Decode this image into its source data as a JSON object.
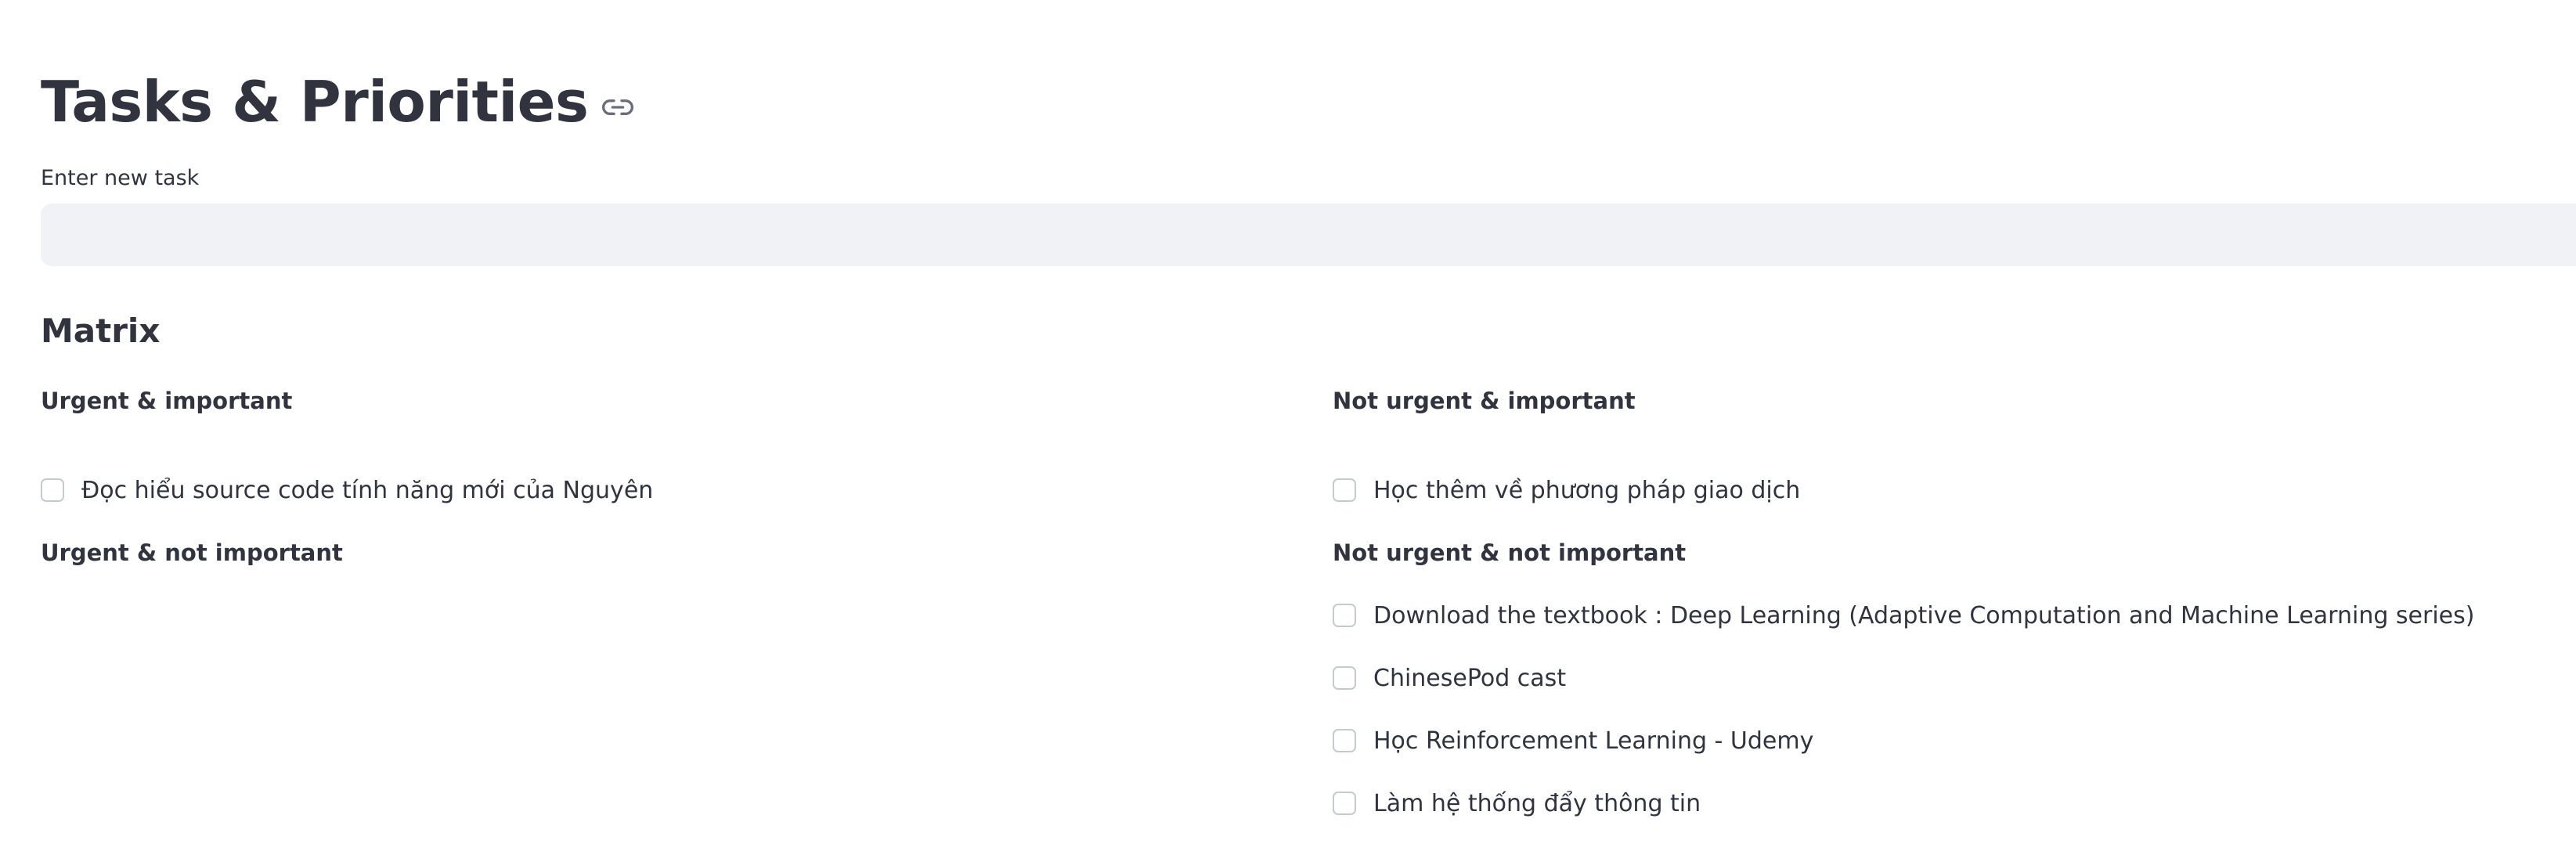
{
  "page": {
    "title": "Tasks & Priorities"
  },
  "input": {
    "label": "Enter new task",
    "value": "",
    "placeholder": ""
  },
  "matrix": {
    "title": "Matrix",
    "quadrants": [
      {
        "title": "Urgent & important",
        "tasks": [
          {
            "label": "Đọc hiểu source code tính năng mới của Nguyên",
            "checked": false
          }
        ]
      },
      {
        "title": "Not urgent & important",
        "tasks": [
          {
            "label": "Học thêm về phương pháp giao dịch",
            "checked": false
          }
        ]
      },
      {
        "title": "Urgent & not important",
        "tasks": []
      },
      {
        "title": "Not urgent & not important",
        "tasks": [
          {
            "label": "Download the textbook : Deep Learning (Adaptive Computation and Machine Learning series)",
            "checked": false
          },
          {
            "label": "ChinesePod cast",
            "checked": false
          },
          {
            "label": "Học Reinforcement Learning - Udemy",
            "checked": false
          },
          {
            "label": "Làm hệ thống đẩy thông tin",
            "checked": false
          }
        ]
      }
    ]
  },
  "icons": {
    "title_anchor": "link-icon",
    "task_checkbox": "checkbox-icon"
  },
  "colors": {
    "text": "#31333f",
    "input_bg": "#f0f2f6",
    "checkbox_border": "#c7c9d0",
    "background": "#ffffff"
  }
}
